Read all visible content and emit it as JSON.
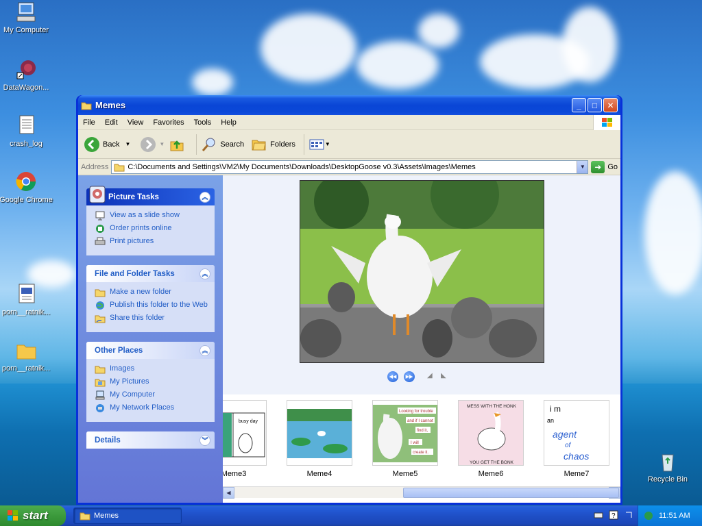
{
  "desktop": {
    "icons": [
      {
        "label": "My Computer"
      },
      {
        "label": "DataWagon..."
      },
      {
        "label": "crash_log"
      },
      {
        "label": "Google Chrome"
      },
      {
        "label": "porn__ratnik..."
      },
      {
        "label": "porn__ratnik..."
      },
      {
        "label": "Recycle Bin"
      }
    ]
  },
  "window": {
    "title": "Memes",
    "menu": [
      "File",
      "Edit",
      "View",
      "Favorites",
      "Tools",
      "Help"
    ],
    "toolbar": {
      "back": "Back",
      "search": "Search",
      "folders": "Folders"
    },
    "address": {
      "label": "Address",
      "path": "C:\\Documents and Settings\\VM2\\My Documents\\Downloads\\DesktopGoose v0.3\\Assets\\Images\\Memes",
      "go": "Go"
    },
    "taskpane": {
      "picture_tasks": {
        "title": "Picture Tasks",
        "items": [
          "View as a slide show",
          "Order prints online",
          "Print pictures"
        ]
      },
      "file_folder_tasks": {
        "title": "File and Folder Tasks",
        "items": [
          "Make a new folder",
          "Publish this folder to the Web",
          "Share this folder"
        ]
      },
      "other_places": {
        "title": "Other Places",
        "items": [
          "Images",
          "My Pictures",
          "My Computer",
          "My Network Places"
        ]
      },
      "details": {
        "title": "Details"
      }
    },
    "thumbnails": [
      {
        "name": "Meme3",
        "text": "busy day"
      },
      {
        "name": "Meme4",
        "text": ""
      },
      {
        "name": "Meme5",
        "lines": [
          "Looking for trouble",
          "and if I cannot",
          "find it,",
          "I will",
          "create it."
        ]
      },
      {
        "name": "Meme6",
        "top": "MESS WITH THE HONK",
        "bottom": "YOU GET THE BONK"
      },
      {
        "name": "Meme7",
        "lines": [
          "i m",
          "an",
          "agent",
          "of",
          "chaos"
        ]
      }
    ]
  },
  "taskbar": {
    "start": "start",
    "item": "Memes",
    "clock": "11:51 AM"
  }
}
